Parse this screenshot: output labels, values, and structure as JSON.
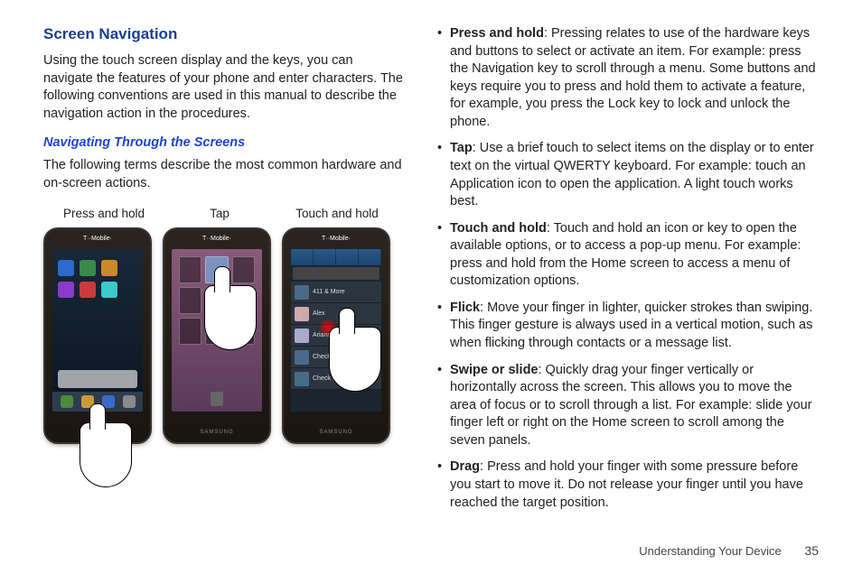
{
  "headings": {
    "section": "Screen Navigation",
    "sub": "Navigating Through the Screens"
  },
  "text": {
    "intro": "Using the touch screen display and the keys, you can navigate the features of your phone and enter characters. The following conventions are used in this manual to describe the navigation action in the procedures.",
    "sub_intro": "The following terms describe the most common hardware and on-screen actions."
  },
  "phone_labels": [
    "Press and hold",
    "Tap",
    "Touch and hold"
  ],
  "carrier": "T··Mobile·",
  "phone_brand": "SAMSUNG",
  "contacts": [
    "411 & More",
    "Alex",
    "Arianna",
    "Check Bala",
    "Check Minu"
  ],
  "definitions": [
    {
      "term": "Press and hold",
      "desc": ": Pressing relates to use of the hardware keys and buttons to select or activate an item. For example: press the Navigation key to scroll through a menu. Some buttons and keys require you to press and hold them to activate a feature, for example, you press the Lock key to lock and unlock the phone."
    },
    {
      "term": "Tap",
      "desc": ": Use a brief touch to select items on the display or to enter text on the virtual QWERTY keyboard. For example: touch an Application icon to open the application. A light touch works best."
    },
    {
      "term": "Touch and hold",
      "desc": ": Touch and hold an icon or key to open the available options, or to access a pop-up menu. For example: press and hold from the Home screen to access a menu of customization options."
    },
    {
      "term": "Flick",
      "desc": ": Move your finger in lighter, quicker strokes than swiping. This finger gesture is always used in a vertical motion, such as when flicking through contacts or a message list."
    },
    {
      "term": "Swipe or slide",
      "desc": ": Quickly drag your finger vertically or horizontally across the screen. This allows you to move the area of focus or to scroll through a list. For example: slide your finger left or right on the Home screen to scroll among the seven panels."
    },
    {
      "term": "Drag",
      "desc": ": Press and hold your finger with some pressure before you start to move it. Do not release your finger until you have reached the target position."
    }
  ],
  "footer": {
    "chapter": "Understanding Your Device",
    "page": "35"
  }
}
